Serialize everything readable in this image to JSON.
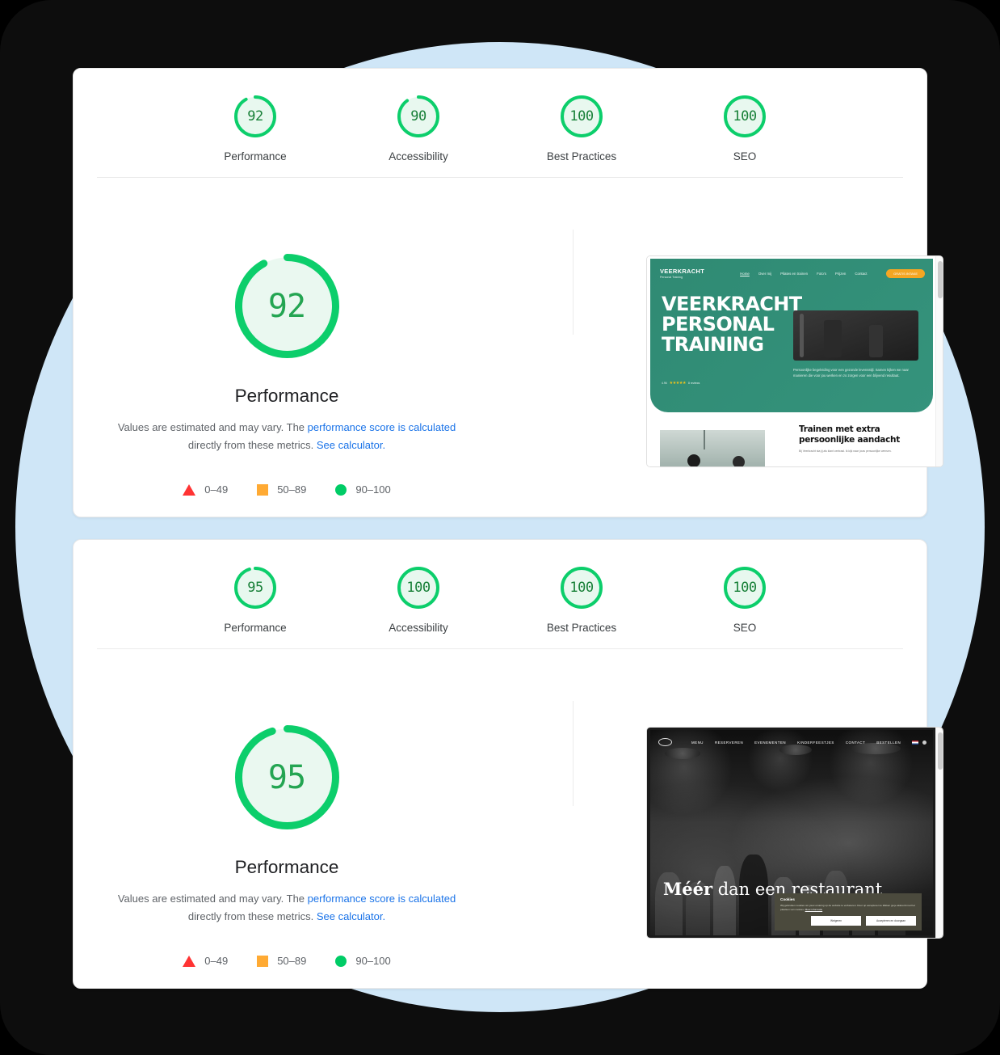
{
  "theme": {
    "green": "#0cce6b",
    "green_dark": "#188038",
    "blue_link": "#1a73e8",
    "circle_bg": "#cfe6f7",
    "plate_bg": "#0d0d0d"
  },
  "reports": [
    {
      "gauges": [
        {
          "value": "92",
          "label": "Performance"
        },
        {
          "value": "90",
          "label": "Accessibility"
        },
        {
          "value": "100",
          "label": "Best Practices"
        },
        {
          "value": "100",
          "label": "SEO"
        }
      ],
      "detail": {
        "score": "92",
        "title": "Performance",
        "note_part1": "Values are estimated and may vary. The ",
        "note_link1": "performance score is calculated",
        "note_part2": " directly from these metrics. ",
        "note_link2": "See calculator."
      },
      "legend": [
        {
          "icon": "triangle",
          "label": "0–49",
          "color": "#ff3333"
        },
        {
          "icon": "square",
          "label": "50–89",
          "color": "#ffaa33"
        },
        {
          "icon": "circle",
          "label": "90–100",
          "color": "#00cc66"
        }
      ],
      "site": {
        "kind": "veerkracht",
        "logo_line1": "VEERKRACHT",
        "logo_line2": "Personal Training",
        "nav": [
          "Home",
          "Over mij",
          "Pilates en trainen",
          "Foto's",
          "Prijzen",
          "Contact"
        ],
        "cta": "GRATIS INTAKE",
        "headline": "VEERKRACHT PERSONAL TRAINING",
        "rating_score": "4.96",
        "rating_stars": "★★★★★",
        "rating_text": "8 reviews",
        "hero_body": "Persoonlijke begeleiding voor een gezonde levensstijl. Samen kijken we naar manieren die voor jou werken en zo zorgen voor een blijvend resultaat.",
        "section_title": "Trainen met extra persoonlijke aandacht",
        "section_body": "Bij Veerkracht sta jij als klant centraal. Ik kijk naar jouw persoonlijke wensen."
      }
    },
    {
      "gauges": [
        {
          "value": "95",
          "label": "Performance"
        },
        {
          "value": "100",
          "label": "Accessibility"
        },
        {
          "value": "100",
          "label": "Best Practices"
        },
        {
          "value": "100",
          "label": "SEO"
        }
      ],
      "detail": {
        "score": "95",
        "title": "Performance",
        "note_part1": "Values are estimated and may vary. The ",
        "note_link1": "performance score is calculated",
        "note_part2": " directly from these metrics. ",
        "note_link2": "See calculator."
      },
      "legend": [
        {
          "icon": "triangle",
          "label": "0–49",
          "color": "#ff3333"
        },
        {
          "icon": "square",
          "label": "50–89",
          "color": "#ffaa33"
        },
        {
          "icon": "circle",
          "label": "90–100",
          "color": "#00cc66"
        }
      ],
      "site": {
        "kind": "restaurant",
        "nav": [
          "MENU",
          "RESERVEREN",
          "EVENEMENTEN",
          "KINDERFEESTJES",
          "CONTACT",
          "BESTELLEN"
        ],
        "headline_bold": "Méér",
        "headline_rest": " dan een restaurant",
        "cookie_title": "Cookies",
        "cookie_body": "Wij gebruiken cookies om jouw ervaring op de website te verbeteren. Door op accepteren te klikken ga je akkoord met het plaatsen van cookies.",
        "cookie_link": "Meer informatie",
        "cookie_btn_decline": "Weigeren",
        "cookie_btn_accept": "Accepteren en doorgaan"
      }
    }
  ]
}
